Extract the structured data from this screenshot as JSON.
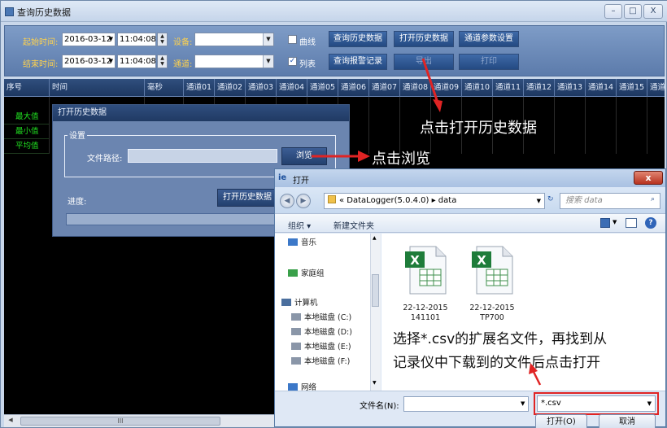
{
  "window": {
    "title": "查询历史数据",
    "minimize": "–",
    "maximize": "□",
    "close": "X"
  },
  "toolbar": {
    "start_label": "起始时间:",
    "start_date": "2016-03-12",
    "start_time": "11:04:08",
    "end_label": "结束时间:",
    "end_date": "2016-03-12",
    "end_time": "11:04:08",
    "device_label": "设备:",
    "channel_label": "通道:",
    "curve_label": "曲线",
    "list_label": "列表",
    "btn_query": "查询历史数据",
    "btn_open": "打开历史数据",
    "btn_params": "通道参数设置",
    "btn_alarm": "查询报警记录",
    "btn_export": "导出",
    "btn_print": "打印"
  },
  "grid": {
    "columns": [
      "序号",
      "时间",
      "毫秒",
      "通道01",
      "通道02",
      "通道03",
      "通道04",
      "通道05",
      "通道06",
      "通道07",
      "通道08",
      "通道09",
      "通道10",
      "通道11",
      "通道12",
      "通道13",
      "通道14",
      "通道15",
      "通道"
    ],
    "row_labels": [
      "最大值",
      "最小值",
      "平均值"
    ],
    "scroll_marker": "III"
  },
  "history_dialog": {
    "title": "打开历史数据",
    "group_label": "设置",
    "path_label": "文件路径:",
    "path_value": "",
    "browse_label": "浏览",
    "open_label": "打开历史数据",
    "progress_label": "进度:"
  },
  "annotations": {
    "click_open": "点击打开历史数据",
    "click_browse": "点击浏览",
    "choose_csv_line1": "选择*.csv的扩展名文件，再找到从",
    "choose_csv_line2": "记录仪中下载到的文件后点击打开"
  },
  "file_dialog": {
    "title": "打开",
    "close": "x",
    "address": "« DataLogger(5.0.4.0) ▸ data",
    "search_placeholder": "搜索 data",
    "organize": "组织 ▾",
    "new_folder": "新建文件夹",
    "nav": [
      {
        "label": "音乐",
        "icon": "music-icon"
      },
      {
        "label": "家庭组",
        "icon": "homegroup-icon"
      },
      {
        "label": "计算机",
        "icon": "computer-icon"
      },
      {
        "label": "本地磁盘 (C:)",
        "icon": "drive-icon"
      },
      {
        "label": "本地磁盘 (D:)",
        "icon": "drive-icon"
      },
      {
        "label": "本地磁盘 (E:)",
        "icon": "drive-icon"
      },
      {
        "label": "本地磁盘 (F:)",
        "icon": "drive-icon"
      },
      {
        "label": "网络",
        "icon": "network-icon"
      }
    ],
    "files": [
      {
        "line1": "22-12-2015",
        "line2": "141101"
      },
      {
        "line1": "22-12-2015",
        "line2": "TP700"
      }
    ],
    "filename_label": "文件名(N):",
    "filename_value": "",
    "filetype_value": "*.csv",
    "open_button": "打开(O)",
    "cancel_button": "取消"
  },
  "colors": {
    "annotation_arrow": "#e02424",
    "stat_labels": "#21e021",
    "toolbar_labels": "#ffd24d"
  }
}
